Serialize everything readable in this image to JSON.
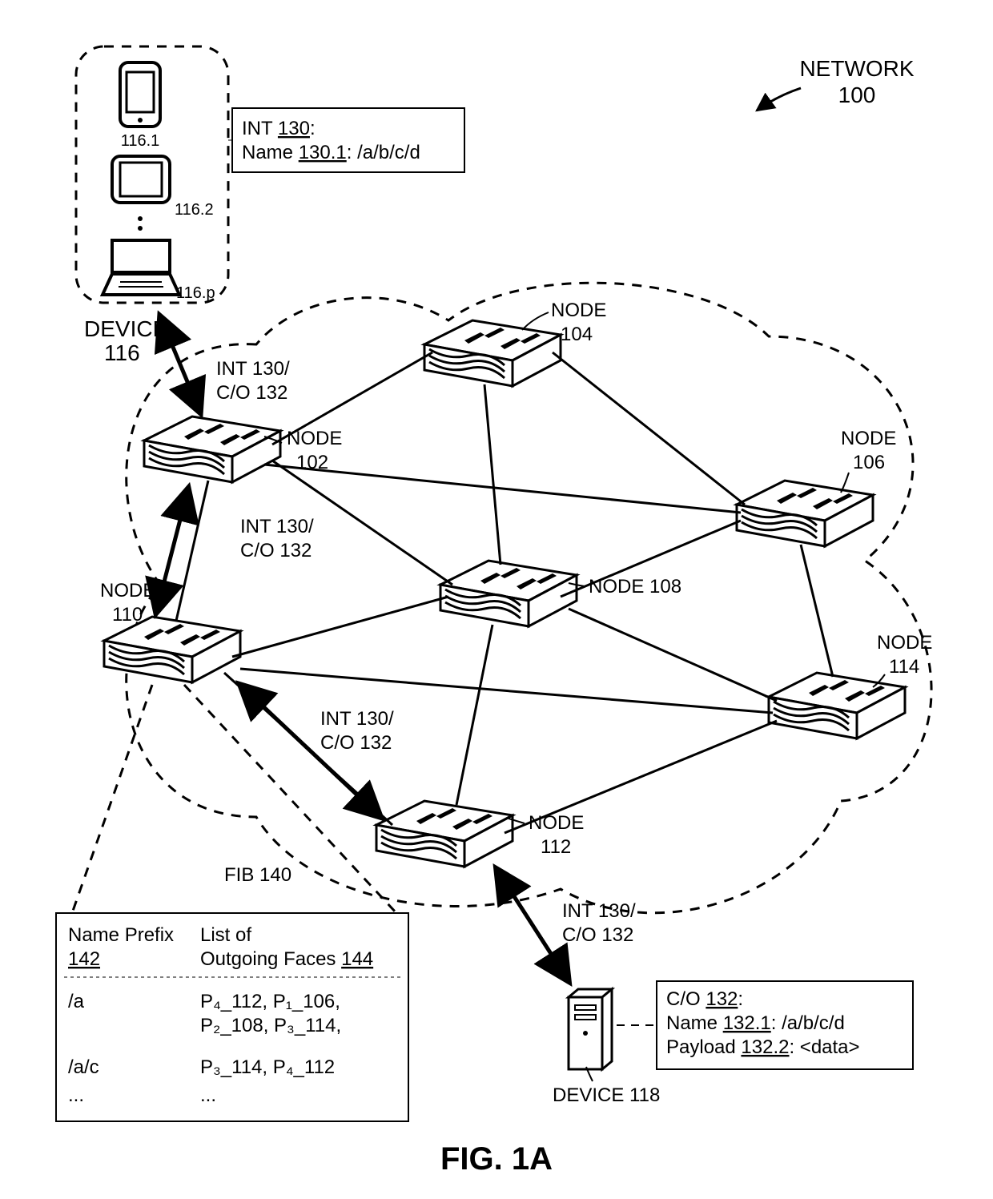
{
  "title": {
    "label": "NETWORK",
    "ref": "100"
  },
  "figure": "FIG. 1A",
  "nodes": {
    "n102": {
      "label": "NODE",
      "ref": "102"
    },
    "n104": {
      "label": "NODE",
      "ref": "104"
    },
    "n106": {
      "label": "NODE",
      "ref": "106"
    },
    "n108": {
      "label": "NODE 108",
      "ref": ""
    },
    "n110": {
      "label": "NODE",
      "ref": "110"
    },
    "n112": {
      "label": "NODE",
      "ref": "112"
    },
    "n114": {
      "label": "NODE",
      "ref": "114"
    }
  },
  "devices": {
    "d116": {
      "label": "DEVICE",
      "ref": "116",
      "items": [
        "116.1",
        "116.2",
        "116.p"
      ]
    },
    "d118": {
      "label": "DEVICE 118"
    }
  },
  "int_box": {
    "l1a": "INT ",
    "l1b": "130",
    "l1c": ":",
    "l2a": "Name ",
    "l2b": "130.1",
    "l2c": ": /a/b/c/d"
  },
  "co_box": {
    "l1a": "C/O ",
    "l1b": "132",
    "l1c": ":",
    "l2a": "Name ",
    "l2b": "132.1",
    "l2c": ": /a/b/c/d",
    "l3a": "Payload ",
    "l3b": "132.2",
    "l3c": ": <data>"
  },
  "fib": {
    "title": "FIB 140",
    "h1a": "Name Prefix",
    "h1b": "142",
    "h2a": "List of",
    "h2b": "Outgoing Faces ",
    "h2c": "144",
    "rows": [
      {
        "prefix": "/a",
        "faces1": "P₄_112, P₁_106,",
        "faces2": "P₂_108, P₃_114,"
      },
      {
        "prefix": "/a/c",
        "faces1": "P₃_114, P₄_112",
        "faces2": ""
      }
    ],
    "ellipsis": "..."
  },
  "link_labels": {
    "a": {
      "l1": "INT 130/",
      "l2": "C/O 132"
    },
    "b": {
      "l1": "INT 130/",
      "l2": "C/O 132"
    },
    "c": {
      "l1": "INT 130/",
      "l2": "C/O 132"
    },
    "d": {
      "l1": "INT 130/",
      "l2": "C/O 132"
    }
  }
}
